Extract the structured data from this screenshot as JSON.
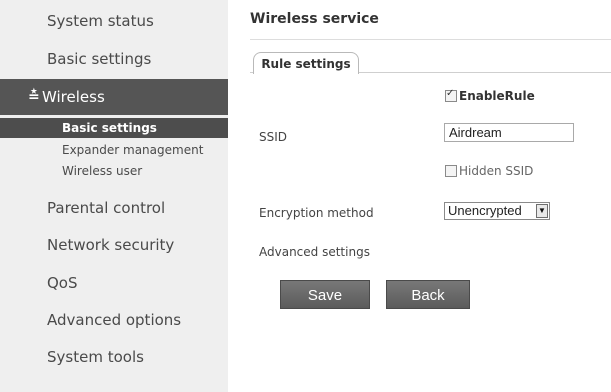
{
  "sidebar": {
    "items": [
      {
        "label": "System status"
      },
      {
        "label": "Basic settings"
      },
      {
        "label": "Wireless",
        "icon": "chevron-double-down-icon"
      },
      {
        "label": "Parental control"
      },
      {
        "label": "Network security"
      },
      {
        "label": "QoS"
      },
      {
        "label": "Advanced options"
      },
      {
        "label": "System tools"
      }
    ],
    "wireless_children": [
      {
        "label": "Basic settings"
      },
      {
        "label": "Expander management"
      },
      {
        "label": "Wireless user"
      }
    ]
  },
  "main": {
    "title": "Wireless service",
    "tab": "Rule settings",
    "enable_rule": {
      "label": "EnableRule",
      "checked": true
    },
    "ssid": {
      "label": "SSID",
      "value": "Airdream"
    },
    "hidden_ssid": {
      "label": "Hidden SSID",
      "checked": false
    },
    "encryption": {
      "label": "Encryption method",
      "value": "Unencrypted"
    },
    "advanced": {
      "label": "Advanced settings"
    },
    "buttons": {
      "save": "Save",
      "back": "Back"
    }
  },
  "colors": {
    "sidebar_bg": "#efefef",
    "active_bg": "#555555",
    "button_bg": "#6b6b6b"
  }
}
